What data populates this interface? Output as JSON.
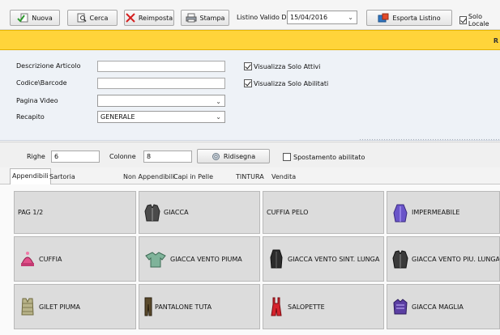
{
  "toolbar": {
    "nuova": "Nuova",
    "cerca": "Cerca",
    "reimposta": "Reimposta",
    "stampa": "Stampa",
    "listino_label": "Listino Valido Dal",
    "listino_date": "15/04/2016",
    "esporta": "Esporta Listino",
    "solo_locale": "Solo Locale"
  },
  "banner": {
    "text": "R"
  },
  "filters": {
    "descrizione_label": "Descrizione Articolo",
    "codice_label": "Codice\\Barcode",
    "pagina_label": "Pagina Video",
    "recapito_label": "Recapito",
    "recapito_value": "GENERALE",
    "solo_attivi": "Visualizza Solo Attivi",
    "solo_abilitati": "Visualizza Solo Abilitati"
  },
  "grid_params": {
    "righe_label": "Righe",
    "righe_value": "6",
    "colonne_label": "Colonne",
    "colonne_value": "8",
    "ridisegna": "Ridisegna",
    "spostamento": "Spostamento abilitato"
  },
  "tabs": [
    "Appendibili",
    "Sartoria",
    "Non Appendibili",
    "Capi in Pelle",
    "TINTURA",
    "Vendita"
  ],
  "items": [
    {
      "label": "PAG 1/2",
      "icon": ""
    },
    {
      "label": "GIACCA",
      "icon": "jacket-icon"
    },
    {
      "label": "CUFFIA PELO",
      "icon": ""
    },
    {
      "label": "IMPERMEABILE",
      "icon": "raincoat-icon"
    },
    {
      "label": "CUFFIA",
      "icon": "hat-icon"
    },
    {
      "label": "GIACCA VENTO PIUMA",
      "icon": "windbreaker-icon"
    },
    {
      "label": "GIACCA VENTO SINT. LUNGA",
      "icon": "long-coat-icon"
    },
    {
      "label": "GIACCA VENTO PIU. LUNGA",
      "icon": "long-jacket-icon"
    },
    {
      "label": "GILET PIUMA",
      "icon": "vest-icon"
    },
    {
      "label": "PANTALONE TUTA",
      "icon": "trousers-icon"
    },
    {
      "label": "SALOPETTE",
      "icon": "salopette-icon"
    },
    {
      "label": "GIACCA MAGLIA",
      "icon": "knit-jacket-icon"
    }
  ]
}
